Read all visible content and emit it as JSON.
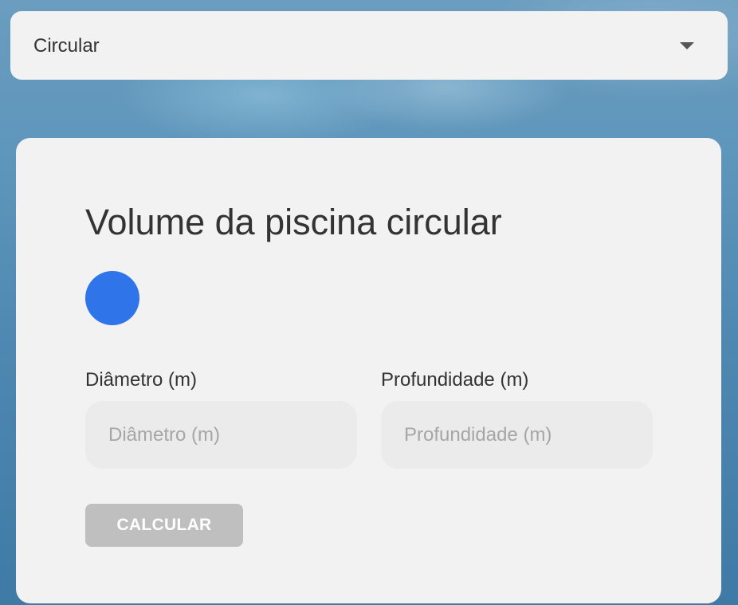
{
  "shape_select": {
    "selected_value": "Circular",
    "icon": "caret-down-icon"
  },
  "card": {
    "title": "Volume da piscina circular",
    "shape_preview": {
      "shape": "circle",
      "color": "#2f74e8"
    },
    "fields": [
      {
        "label": "Diâmetro (m)",
        "placeholder": "Diâmetro (m)",
        "value": ""
      },
      {
        "label": "Profundidade (m)",
        "placeholder": "Profundidade (m)",
        "value": ""
      }
    ],
    "calculate_button_label": "CALCULAR"
  },
  "colors": {
    "card_background": "#f2f2f2",
    "input_background": "#ebebeb",
    "button_disabled": "#bfbfbf",
    "accent": "#2f74e8"
  }
}
